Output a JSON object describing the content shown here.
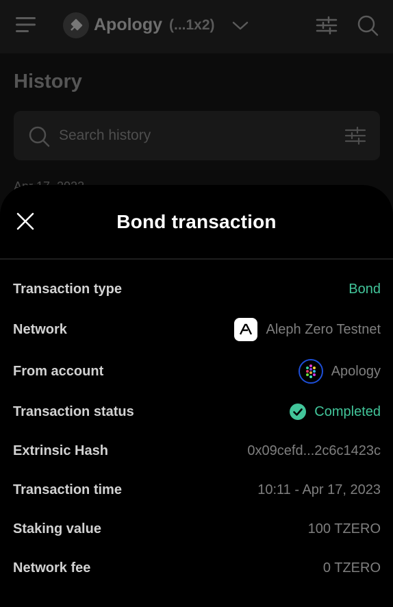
{
  "app": {
    "account_name": "Apology",
    "account_address": "(...1x2)",
    "history_title": "History",
    "search_placeholder": "Search history",
    "history_date": "Apr 17, 2023"
  },
  "sheet": {
    "title": "Bond transaction",
    "rows": [
      {
        "label": "Transaction type",
        "value": "Bond"
      },
      {
        "label": "Network",
        "value": "Aleph Zero Testnet"
      },
      {
        "label": "From account",
        "value": "Apology"
      },
      {
        "label": "Transaction status",
        "value": "Completed"
      },
      {
        "label": "Extrinsic Hash",
        "value": "0x09cefd...2c6c1423c"
      },
      {
        "label": "Transaction time",
        "value": "10:11 - Apr 17, 2023"
      },
      {
        "label": "Staking value",
        "value": "100 TZERO"
      },
      {
        "label": "Network fee",
        "value": "0 TZERO"
      }
    ]
  },
  "colors": {
    "accent_green": "#42c59a",
    "avatar_ring": "#1d4fd8",
    "sheet_bg": "#000000"
  },
  "icons": [
    "menu-icon",
    "chevron-down-icon",
    "filter-icon",
    "search-icon",
    "close-icon",
    "aleph-zero-icon",
    "check-circle-icon",
    "account-avatar-icon"
  ]
}
